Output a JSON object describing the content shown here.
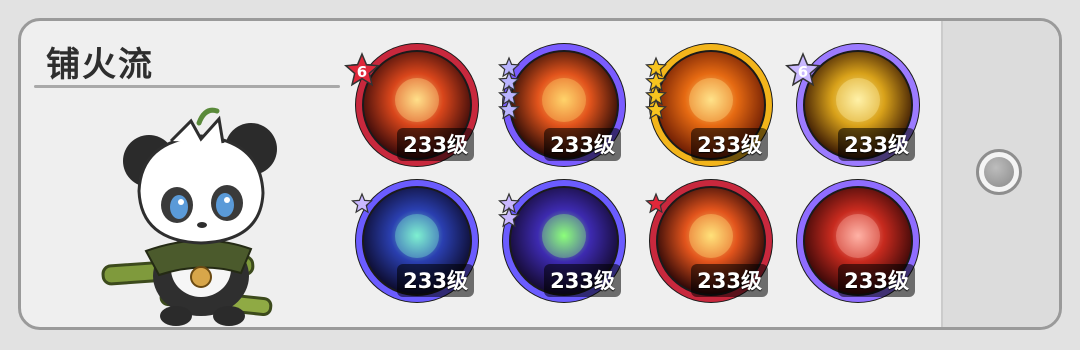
{
  "build": {
    "title": "铺火流"
  },
  "character": {
    "icon": "panda-hero-icon"
  },
  "skills": [
    {
      "name": "skill-1",
      "level": "233级",
      "rim": "#c8283d",
      "c1": "#ffe08a",
      "c2": "#d9461b",
      "c3": "#3a0a0a",
      "star_color": "#e0283a",
      "star_count": 1,
      "badge": "6"
    },
    {
      "name": "skill-2",
      "level": "233级",
      "rim": "#7a5cff",
      "c1": "#ffd36b",
      "c2": "#e2541c",
      "c3": "#2a0b06",
      "star_color": "#b9b4ff",
      "star_count": 4,
      "badge": ""
    },
    {
      "name": "skill-3",
      "level": "233级",
      "rim": "#f3b51b",
      "c1": "#ffe38a",
      "c2": "#e66a12",
      "c3": "#6e1d04",
      "star_color": "#f7c41e",
      "star_count": 4,
      "badge": ""
    },
    {
      "name": "skill-4",
      "level": "233级",
      "rim": "#9c7bff",
      "c1": "#fff2a8",
      "c2": "#d9a21a",
      "c3": "#3b1a04",
      "star_color": "#c9b8ff",
      "star_count": 1,
      "badge": "6"
    },
    {
      "name": "skill-5",
      "level": "233级",
      "rim": "#6b5cff",
      "c1": "#7ef0d0",
      "c2": "#2a3fb0",
      "c3": "#0d0c2e",
      "star_color": "#c9b8ff",
      "star_count": 1,
      "badge": ""
    },
    {
      "name": "skill-6",
      "level": "233级",
      "rim": "#6b5cff",
      "c1": "#8cff7a",
      "c2": "#3d2ab0",
      "c3": "#150b33",
      "star_color": "#c9b8ff",
      "star_count": 2,
      "badge": ""
    },
    {
      "name": "skill-7",
      "level": "233级",
      "rim": "#c8283d",
      "c1": "#ffe27a",
      "c2": "#e2541c",
      "c3": "#2e0707",
      "star_color": "#e0283a",
      "star_count": 1,
      "badge": ""
    },
    {
      "name": "skill-8",
      "level": "233级",
      "rim": "#8f6dff",
      "c1": "#ffb3a6",
      "c2": "#c72a1e",
      "c3": "#3a0808",
      "star_color": "#c9b8ff",
      "star_count": 0,
      "badge": ""
    }
  ]
}
